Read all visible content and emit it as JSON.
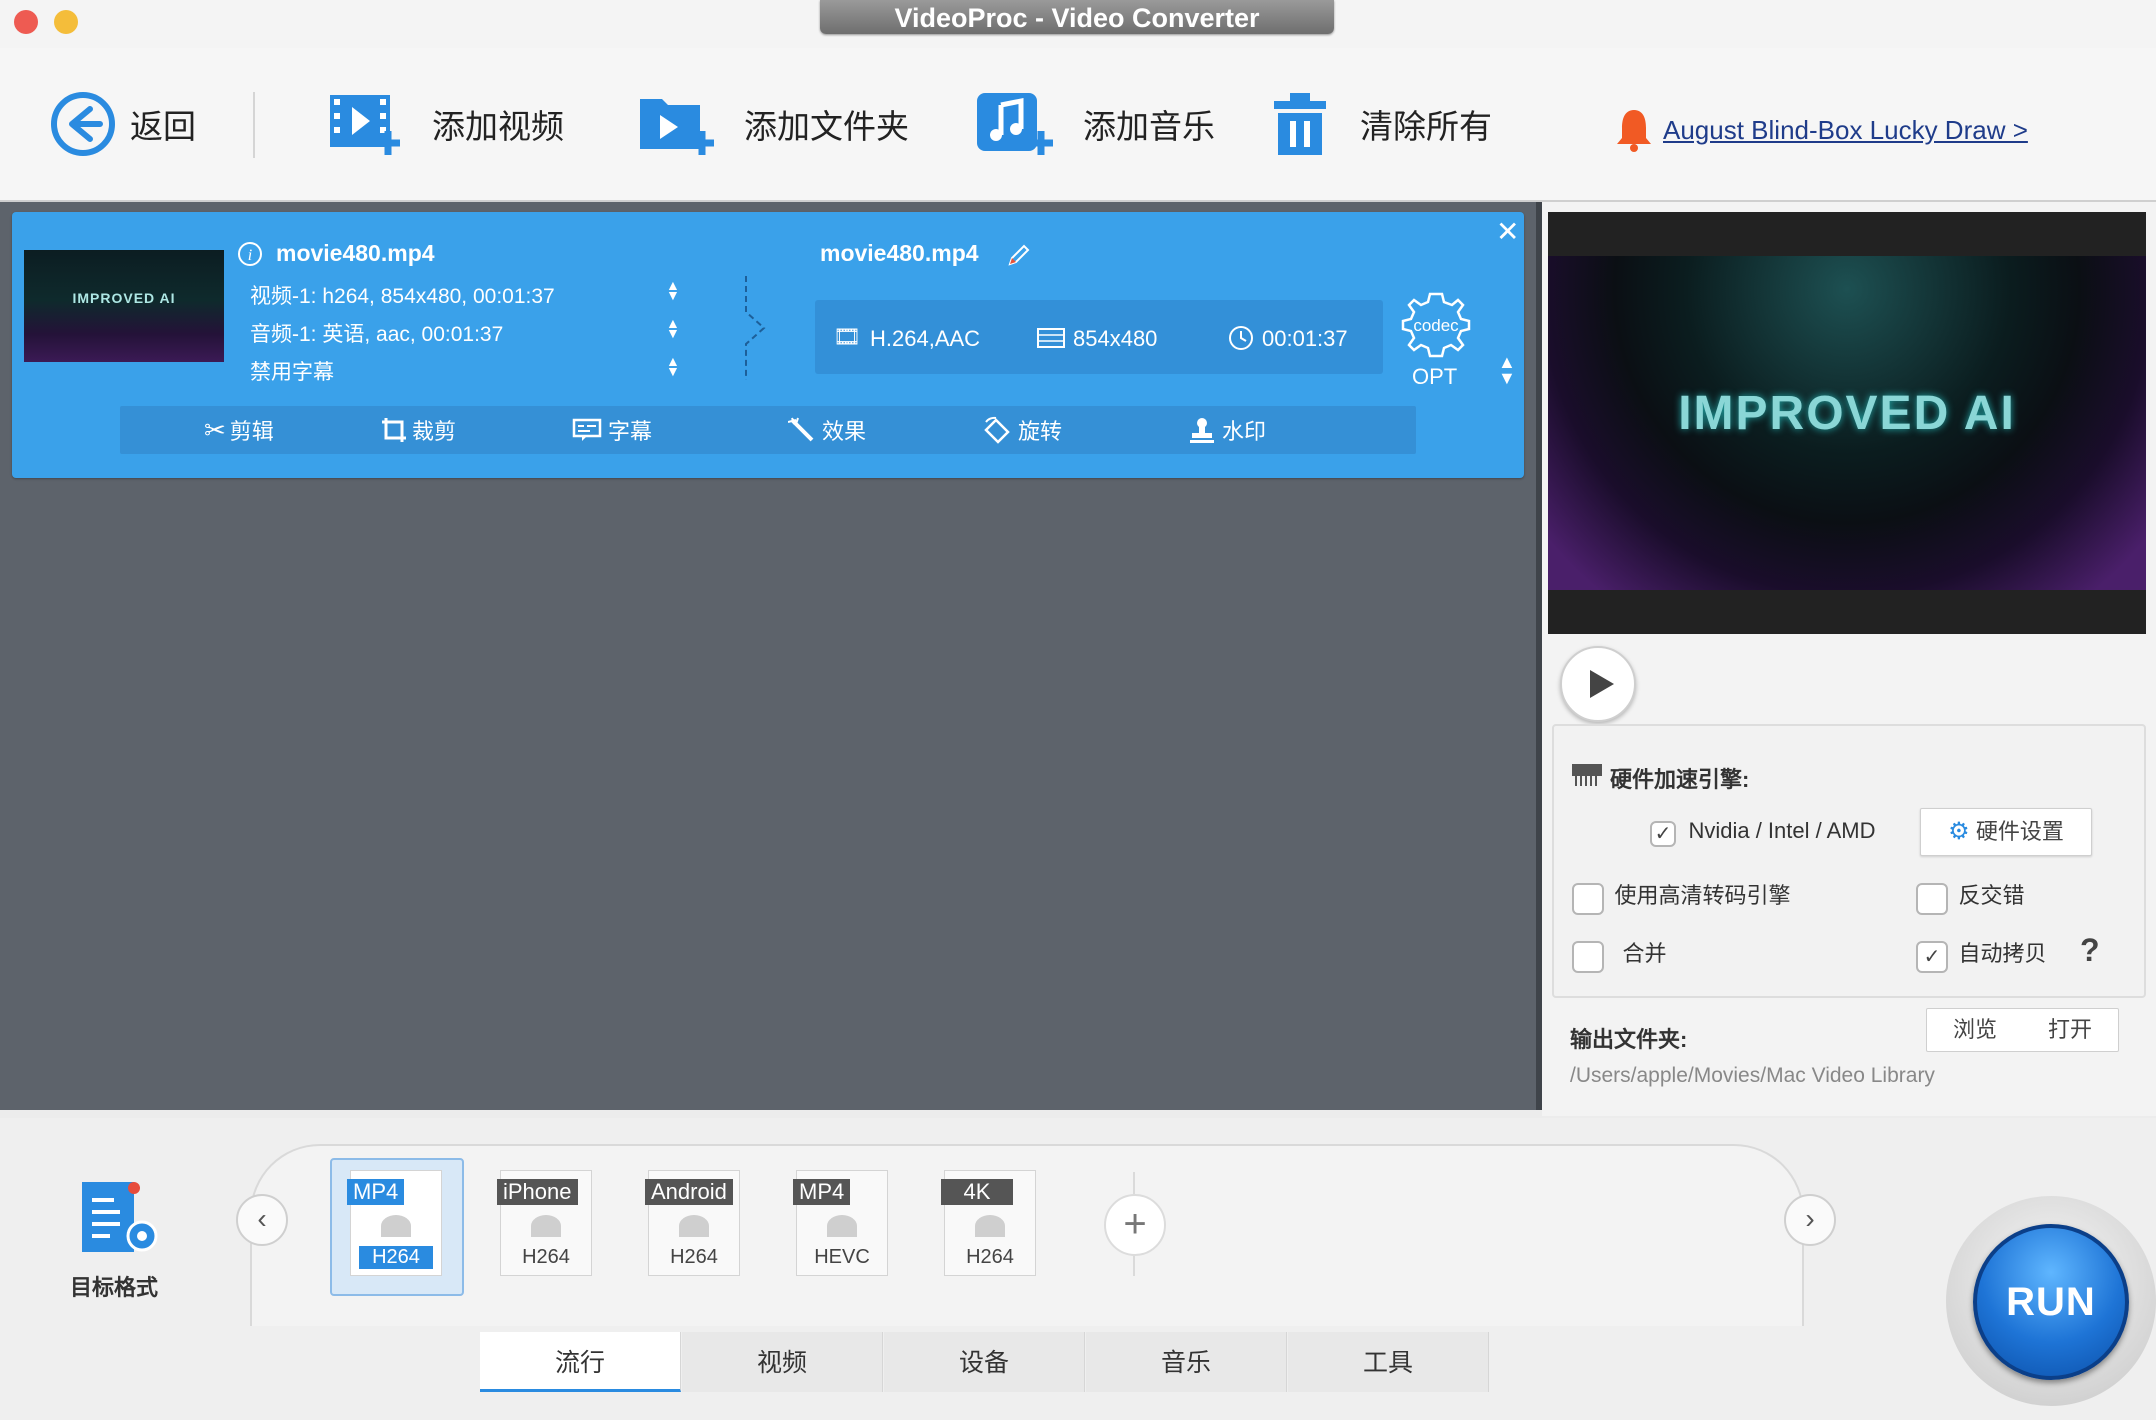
{
  "window": {
    "title": "VideoProc - Video Converter"
  },
  "toolbar": {
    "back": "返回",
    "add_video": "添加视频",
    "add_folder": "添加文件夹",
    "add_music": "添加音乐",
    "clear_all": "清除所有",
    "promo": "August Blind-Box Lucky Draw >"
  },
  "item": {
    "source_name": "movie480.mp4",
    "video_track": "视频-1: h264, 854x480, 00:01:37",
    "audio_track": "音频-1: 英语, aac, 00:01:37",
    "subtitle": "禁用字幕",
    "thumb_text": "IMPROVED AI",
    "output_name": "movie480.mp4",
    "codec": "H.264,AAC",
    "resolution": "854x480",
    "duration": "00:01:37",
    "codec_badge": "codec",
    "opt": "OPT"
  },
  "actions": [
    "剪辑",
    "裁剪",
    "字幕",
    "效果",
    "旋转",
    "水印"
  ],
  "preview": {
    "overlay_text": "IMPROVED AI"
  },
  "hw": {
    "title": "硬件加速引擎:",
    "gpu_label": "Nvidia /  Intel / AMD",
    "settings_button": "硬件设置",
    "hq_engine": "使用高清转码引擎",
    "deinterlace": "反交错",
    "merge": "合并",
    "auto_copy": "自动拷贝",
    "help": "?"
  },
  "output": {
    "label": "输出文件夹:",
    "browse": "浏览",
    "open": "打开",
    "path": "/Users/apple/Movies/Mac Video Library"
  },
  "target": {
    "label": "目标格式"
  },
  "formats": [
    {
      "top": "MP4",
      "bottom": "H264",
      "selected": true
    },
    {
      "top": "iPhone",
      "bottom": "H264"
    },
    {
      "top": "Android",
      "bottom": "H264"
    },
    {
      "top": "MP4",
      "bottom": "HEVC"
    },
    {
      "top": "4K",
      "bottom": "H264"
    }
  ],
  "tabs": [
    "流行",
    "视频",
    "设备",
    "音乐",
    "工具"
  ],
  "run": "RUN",
  "colors": {
    "accent": "#3aa1ea",
    "toolbar_icon": "#2a8be0",
    "promo_bell": "#f15a24"
  }
}
